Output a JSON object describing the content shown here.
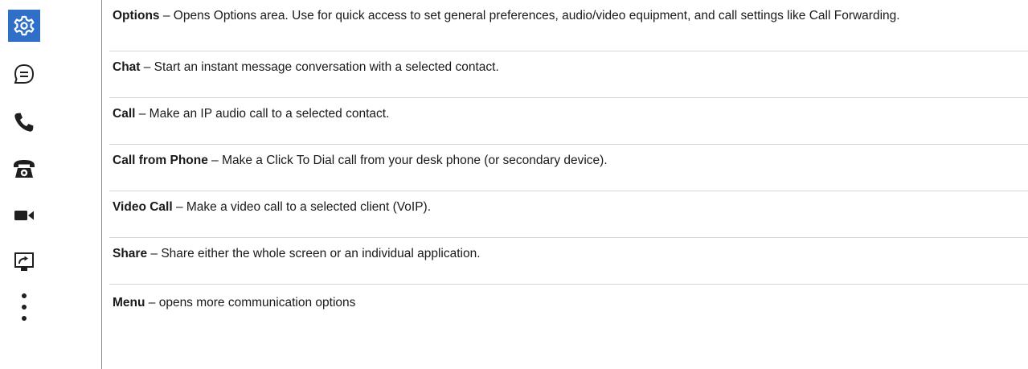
{
  "rows": [
    {
      "icon": "gear-icon",
      "term": "Options",
      "description": " – Opens Options area. Use for quick access to set general preferences, audio/video equipment, and call settings like Call Forwarding."
    },
    {
      "icon": "chat-bubble-icon",
      "term": "Chat",
      "description": " – Start an instant message conversation with a selected contact."
    },
    {
      "icon": "phone-handset-icon",
      "term": "Call",
      "description": " – Make an IP audio call to a selected contact."
    },
    {
      "icon": "desk-phone-icon",
      "term": "Call from Phone",
      "description": " – Make a Click To Dial call from your desk phone (or secondary device)."
    },
    {
      "icon": "video-camera-icon",
      "term": "Video Call",
      "description": " – Make a video call to a selected client (VoIP)."
    },
    {
      "icon": "share-screen-icon",
      "term": "Share",
      "description": " – Share either the whole screen or an individual application."
    },
    {
      "icon": "more-vertical-icon",
      "term": "Menu",
      "description": " – opens more communication options"
    }
  ],
  "colors": {
    "gear_background": "#2f6fc7",
    "icon_dark": "#1f1f1f"
  }
}
